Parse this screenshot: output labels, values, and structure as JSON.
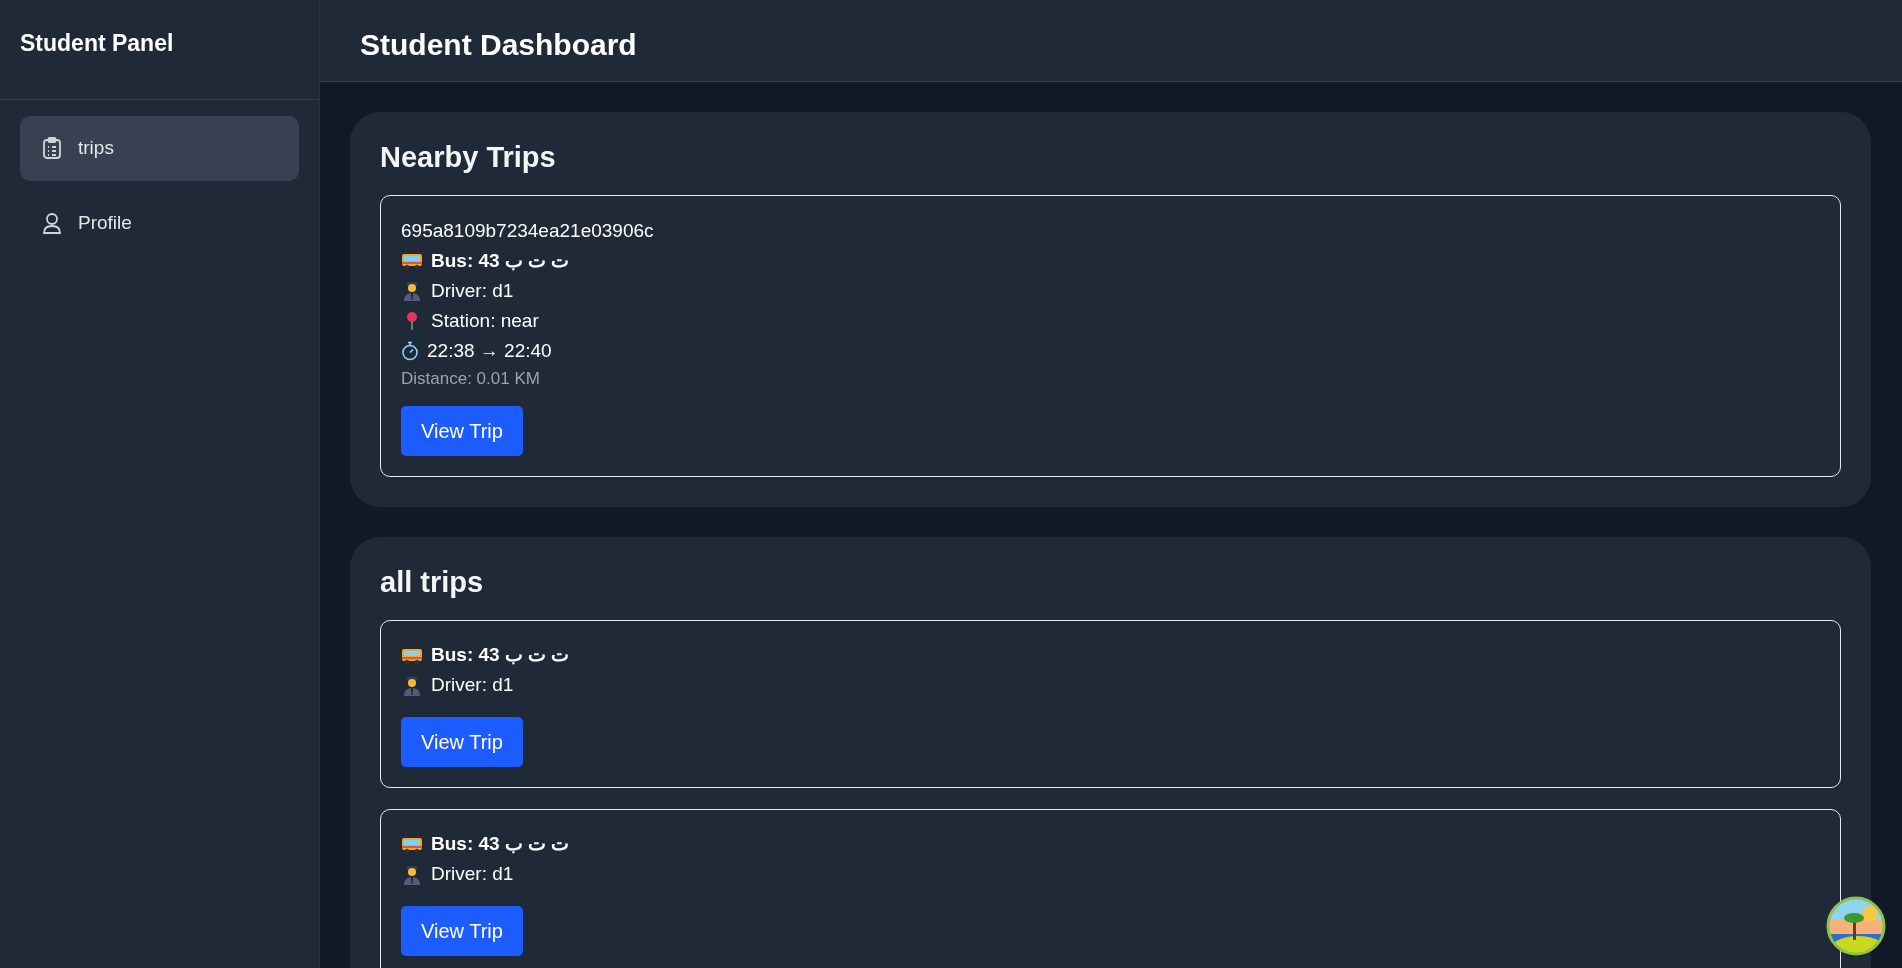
{
  "sidebar": {
    "title": "Student Panel",
    "items": [
      {
        "label": "trips",
        "selected": true
      },
      {
        "label": "Profile",
        "selected": false
      }
    ]
  },
  "header": {
    "title": "Student Dashboard"
  },
  "sections": [
    {
      "title": "Nearby Trips",
      "trips": [
        {
          "id": "695a8109b7234ea21e03906c",
          "bus": "Bus: 43 ت ت ب",
          "driver": "Driver: d1",
          "station": "Station: near",
          "time": "22:38 → 22:40",
          "distance": "Distance: 0.01 KM",
          "button": "View Trip"
        }
      ]
    },
    {
      "title": "all trips",
      "trips": [
        {
          "bus": "Bus: 43 ت ت ب",
          "driver": "Driver: d1",
          "button": "View Trip"
        },
        {
          "bus": "Bus: 43 ت ت ب",
          "driver": "Driver: d1",
          "button": "View Trip"
        }
      ]
    }
  ]
}
